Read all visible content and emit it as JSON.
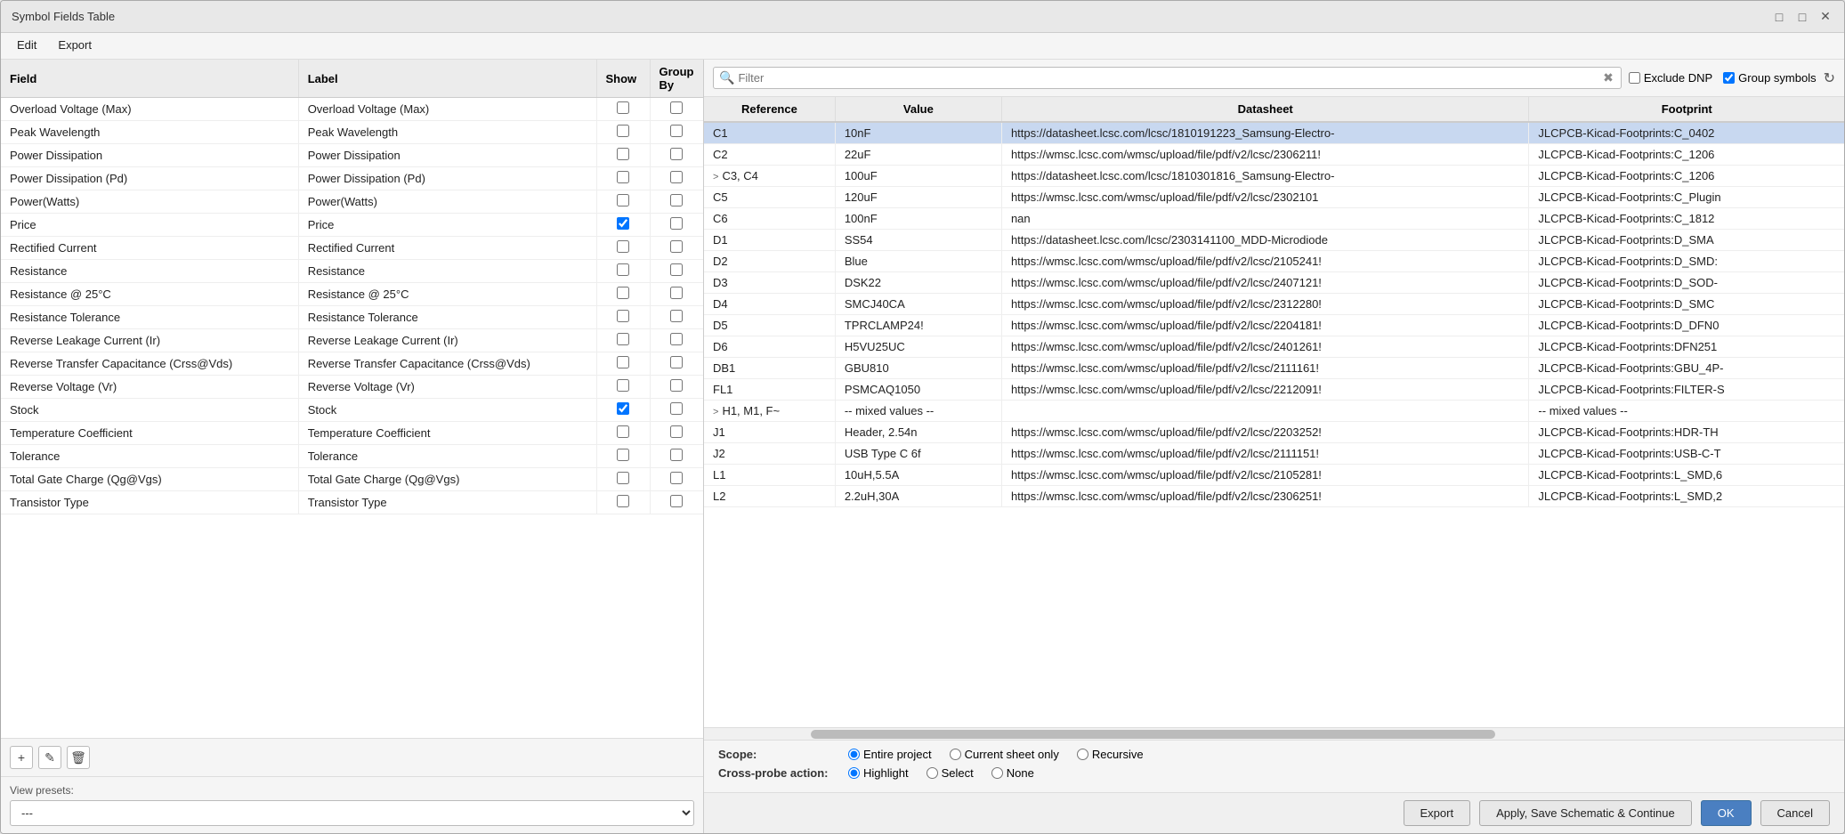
{
  "window": {
    "title": "Symbol Fields Table",
    "minimize_label": "minimize",
    "maximize_label": "maximize",
    "close_label": "close"
  },
  "menu": {
    "items": [
      "Edit",
      "Export"
    ]
  },
  "left_panel": {
    "columns": {
      "field": "Field",
      "label": "Label",
      "show": "Show",
      "group_by": "Group By"
    },
    "rows": [
      {
        "field": "Overload Voltage (Max)",
        "label": "Overload Voltage (Max)",
        "show": false,
        "group_by": false
      },
      {
        "field": "Peak Wavelength",
        "label": "Peak Wavelength",
        "show": false,
        "group_by": false
      },
      {
        "field": "Power Dissipation",
        "label": "Power Dissipation",
        "show": false,
        "group_by": false
      },
      {
        "field": "Power Dissipation (Pd)",
        "label": "Power Dissipation (Pd)",
        "show": false,
        "group_by": false
      },
      {
        "field": "Power(Watts)",
        "label": "Power(Watts)",
        "show": false,
        "group_by": false
      },
      {
        "field": "Price",
        "label": "Price",
        "show": true,
        "group_by": false
      },
      {
        "field": "Rectified Current",
        "label": "Rectified Current",
        "show": false,
        "group_by": false
      },
      {
        "field": "Resistance",
        "label": "Resistance",
        "show": false,
        "group_by": false
      },
      {
        "field": "Resistance @ 25°C",
        "label": "Resistance @ 25°C",
        "show": false,
        "group_by": false
      },
      {
        "field": "Resistance Tolerance",
        "label": "Resistance Tolerance",
        "show": false,
        "group_by": false
      },
      {
        "field": "Reverse Leakage Current (Ir)",
        "label": "Reverse Leakage Current (Ir)",
        "show": false,
        "group_by": false
      },
      {
        "field": "Reverse Transfer Capacitance (Crss@Vds)",
        "label": "Reverse Transfer Capacitance (Crss@Vds)",
        "show": false,
        "group_by": false
      },
      {
        "field": "Reverse Voltage (Vr)",
        "label": "Reverse Voltage (Vr)",
        "show": false,
        "group_by": false
      },
      {
        "field": "Stock",
        "label": "Stock",
        "show": true,
        "group_by": false
      },
      {
        "field": "Temperature Coefficient",
        "label": "Temperature Coefficient",
        "show": false,
        "group_by": false
      },
      {
        "field": "Tolerance",
        "label": "Tolerance",
        "show": false,
        "group_by": false
      },
      {
        "field": "Total Gate Charge (Qg@Vgs)",
        "label": "Total Gate Charge (Qg@Vgs)",
        "show": false,
        "group_by": false
      },
      {
        "field": "Transistor Type",
        "label": "Transistor Type",
        "show": false,
        "group_by": false
      }
    ],
    "toolbar": {
      "add_label": "+",
      "edit_label": "✎",
      "delete_label": "🗑"
    },
    "presets": {
      "label": "View presets:",
      "value": "---",
      "options": [
        "---"
      ]
    }
  },
  "right_panel": {
    "filter": {
      "placeholder": "Filter",
      "value": "",
      "exclude_dnp_label": "Exclude DNP",
      "exclude_dnp_checked": false,
      "group_symbols_label": "Group symbols",
      "group_symbols_checked": true
    },
    "columns": {
      "reference": "Reference",
      "value": "Value",
      "datasheet": "Datasheet",
      "footprint": "Footprint"
    },
    "rows": [
      {
        "ref": "C1",
        "value": "10nF",
        "datasheet": "https://datasheet.lcsc.com/lcsc/1810191223_Samsung-Electro-",
        "footprint": "JLCPCB-Kicad-Footprints:C_0402",
        "selected": true,
        "group": false
      },
      {
        "ref": "C2",
        "value": "22uF",
        "datasheet": "https://wmsc.lcsc.com/wmsc/upload/file/pdf/v2/lcsc/2306211!",
        "footprint": "JLCPCB-Kicad-Footprints:C_1206",
        "selected": false,
        "group": false
      },
      {
        "ref": "C3, C4",
        "value": "100uF",
        "datasheet": "https://datasheet.lcsc.com/lcsc/1810301816_Samsung-Electro-",
        "footprint": "JLCPCB-Kicad-Footprints:C_1206",
        "selected": false,
        "group": true,
        "expand": ">"
      },
      {
        "ref": "C5",
        "value": "120uF",
        "datasheet": "https://wmsc.lcsc.com/wmsc/upload/file/pdf/v2/lcsc/2302101",
        "footprint": "JLCPCB-Kicad-Footprints:C_Plugin",
        "selected": false,
        "group": false
      },
      {
        "ref": "C6",
        "value": "100nF",
        "datasheet": "nan",
        "footprint": "JLCPCB-Kicad-Footprints:C_1812",
        "selected": false,
        "group": false
      },
      {
        "ref": "D1",
        "value": "SS54",
        "datasheet": "https://datasheet.lcsc.com/lcsc/2303141100_MDD-Microdiode",
        "footprint": "JLCPCB-Kicad-Footprints:D_SMA",
        "selected": false,
        "group": false
      },
      {
        "ref": "D2",
        "value": "Blue",
        "datasheet": "https://wmsc.lcsc.com/wmsc/upload/file/pdf/v2/lcsc/2105241!",
        "footprint": "JLCPCB-Kicad-Footprints:D_SMD:",
        "selected": false,
        "group": false
      },
      {
        "ref": "D3",
        "value": "DSK22",
        "datasheet": "https://wmsc.lcsc.com/wmsc/upload/file/pdf/v2/lcsc/2407121!",
        "footprint": "JLCPCB-Kicad-Footprints:D_SOD-",
        "selected": false,
        "group": false
      },
      {
        "ref": "D4",
        "value": "SMCJ40CA",
        "datasheet": "https://wmsc.lcsc.com/wmsc/upload/file/pdf/v2/lcsc/2312280!",
        "footprint": "JLCPCB-Kicad-Footprints:D_SMC",
        "selected": false,
        "group": false
      },
      {
        "ref": "D5",
        "value": "TPRCLAMP24!",
        "datasheet": "https://wmsc.lcsc.com/wmsc/upload/file/pdf/v2/lcsc/2204181!",
        "footprint": "JLCPCB-Kicad-Footprints:D_DFN0",
        "selected": false,
        "group": false
      },
      {
        "ref": "D6",
        "value": "H5VU25UC",
        "datasheet": "https://wmsc.lcsc.com/wmsc/upload/file/pdf/v2/lcsc/2401261!",
        "footprint": "JLCPCB-Kicad-Footprints:DFN251",
        "selected": false,
        "group": false
      },
      {
        "ref": "DB1",
        "value": "GBU810",
        "datasheet": "https://wmsc.lcsc.com/wmsc/upload/file/pdf/v2/lcsc/2111161!",
        "footprint": "JLCPCB-Kicad-Footprints:GBU_4P-",
        "selected": false,
        "group": false
      },
      {
        "ref": "FL1",
        "value": "PSMCAQ1050",
        "datasheet": "https://wmsc.lcsc.com/wmsc/upload/file/pdf/v2/lcsc/2212091!",
        "footprint": "JLCPCB-Kicad-Footprints:FILTER-S",
        "selected": false,
        "group": false
      },
      {
        "ref": "H1, M1, F~",
        "value": "-- mixed values --",
        "datasheet": "",
        "footprint": "-- mixed values --",
        "selected": false,
        "group": true,
        "expand": ">"
      },
      {
        "ref": "J1",
        "value": "Header, 2.54n",
        "datasheet": "https://wmsc.lcsc.com/wmsc/upload/file/pdf/v2/lcsc/2203252!",
        "footprint": "JLCPCB-Kicad-Footprints:HDR-TH",
        "selected": false,
        "group": false
      },
      {
        "ref": "J2",
        "value": "USB Type C 6f",
        "datasheet": "https://wmsc.lcsc.com/wmsc/upload/file/pdf/v2/lcsc/2111151!",
        "footprint": "JLCPCB-Kicad-Footprints:USB-C-T",
        "selected": false,
        "group": false
      },
      {
        "ref": "L1",
        "value": "10uH,5.5A",
        "datasheet": "https://wmsc.lcsc.com/wmsc/upload/file/pdf/v2/lcsc/2105281!",
        "footprint": "JLCPCB-Kicad-Footprints:L_SMD,6",
        "selected": false,
        "group": false
      },
      {
        "ref": "L2",
        "value": "2.2uH,30A",
        "datasheet": "https://wmsc.lcsc.com/wmsc/upload/file/pdf/v2/lcsc/2306251!",
        "footprint": "JLCPCB-Kicad-Footprints:L_SMD,2",
        "selected": false,
        "group": false
      }
    ],
    "scope": {
      "label": "Scope:",
      "options": [
        {
          "value": "entire_project",
          "label": "Entire project",
          "selected": true
        },
        {
          "value": "current_sheet",
          "label": "Current sheet only",
          "selected": false
        },
        {
          "value": "recursive",
          "label": "Recursive",
          "selected": false
        }
      ]
    },
    "crossprobe": {
      "label": "Cross-probe action:",
      "options": [
        {
          "value": "highlight",
          "label": "Highlight",
          "selected": true
        },
        {
          "value": "select",
          "label": "Select",
          "selected": false
        },
        {
          "value": "none",
          "label": "None",
          "selected": false
        }
      ]
    }
  },
  "actions": {
    "export": "Export",
    "apply_save": "Apply, Save Schematic & Continue",
    "ok": "OK",
    "cancel": "Cancel"
  }
}
